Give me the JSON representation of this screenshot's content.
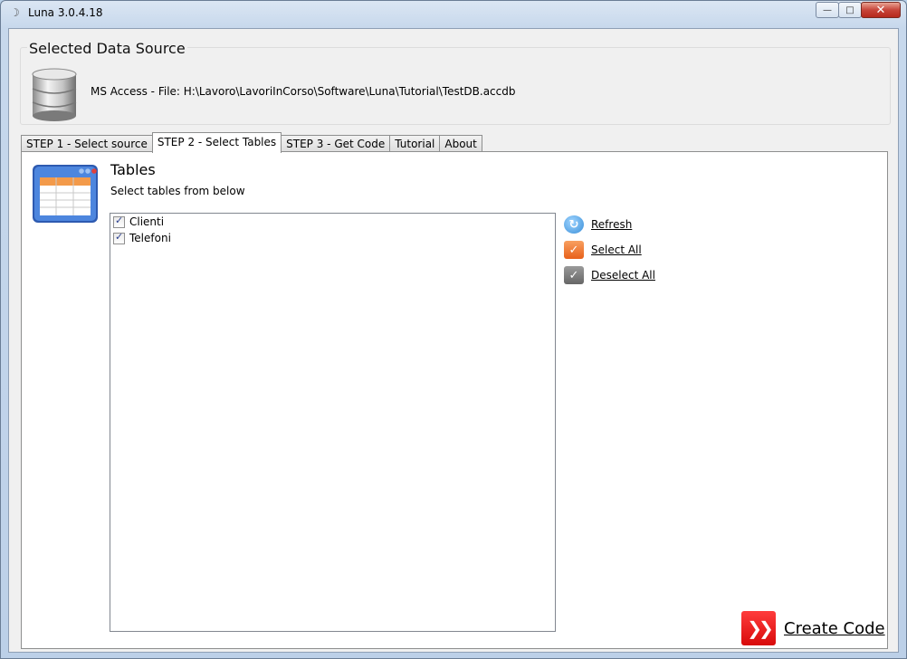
{
  "window": {
    "title": "Luna 3.0.4.18",
    "minimize_label": "—",
    "maximize_label": "□",
    "close_label": "✕"
  },
  "datasource": {
    "group_title": "Selected Data Source",
    "text": "MS Access - File: H:\\Lavoro\\LavoriInCorso\\Software\\Luna\\Tutorial\\TestDB.accdb"
  },
  "tabs": [
    {
      "label": "STEP 1 - Select source"
    },
    {
      "label": "STEP 2 - Select Tables"
    },
    {
      "label": "STEP 3 - Get Code"
    },
    {
      "label": "Tutorial"
    },
    {
      "label": "About"
    }
  ],
  "panel": {
    "title": "Tables",
    "subtitle": "Select tables from below"
  },
  "tables_list": [
    {
      "name": "Clienti",
      "checked": true
    },
    {
      "name": "Telefoni",
      "checked": true
    }
  ],
  "actions": {
    "refresh": "Refresh",
    "select_all": "Select All",
    "deselect_all": "Deselect All"
  },
  "create": {
    "label": "Create Code"
  },
  "colors": {
    "refresh_icon": "#3a8fd8",
    "select_all_icon": "#f07a2a",
    "deselect_all_icon": "#7a7a7a",
    "create_icon": "#e01010"
  }
}
